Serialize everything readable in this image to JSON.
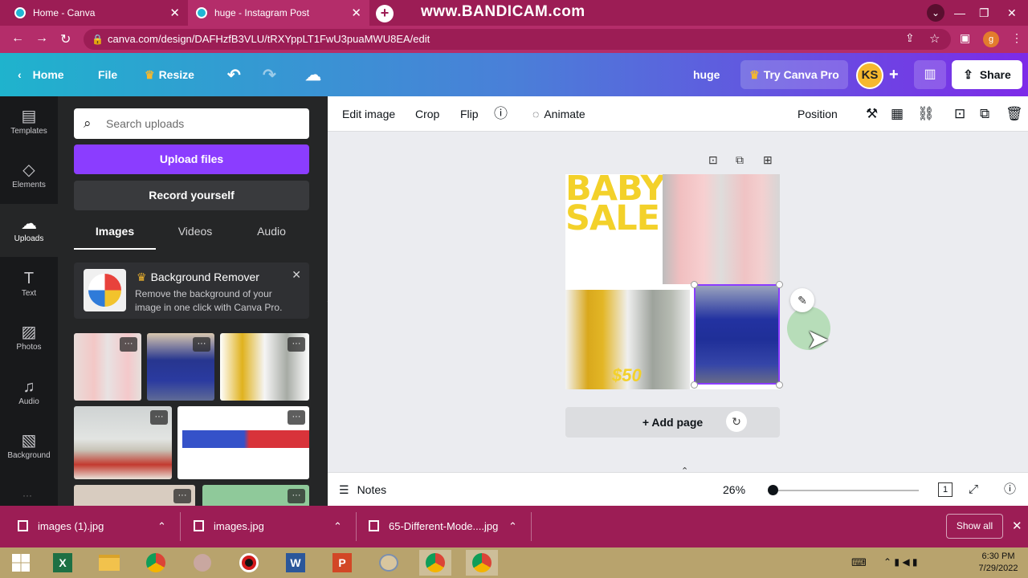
{
  "browser": {
    "tabs": [
      {
        "title": "Home - Canva"
      },
      {
        "title": "huge - Instagram Post"
      }
    ],
    "watermark": "www.BANDICAM.com",
    "url": "canva.com/design/DAFHzfB3VLU/tRXYppLT1FwU3puaMWU8EA/edit",
    "profile_initial": "g"
  },
  "header": {
    "home": "Home",
    "file": "File",
    "resize": "Resize",
    "doc_title": "huge",
    "try_pro": "Try Canva Pro",
    "avatar": "KS",
    "share": "Share",
    "accent": "#7d2ae8"
  },
  "rail": [
    {
      "label": "Templates",
      "icon": "templates-icon"
    },
    {
      "label": "Elements",
      "icon": "elements-icon"
    },
    {
      "label": "Uploads",
      "icon": "uploads-icon"
    },
    {
      "label": "Text",
      "icon": "text-icon"
    },
    {
      "label": "Photos",
      "icon": "photos-icon"
    },
    {
      "label": "Audio",
      "icon": "audio-icon"
    },
    {
      "label": "Background",
      "icon": "background-icon"
    }
  ],
  "panel": {
    "search_placeholder": "Search uploads",
    "upload_files": "Upload files",
    "record_yourself": "Record yourself",
    "tabs": [
      "Images",
      "Videos",
      "Audio"
    ],
    "promo_title": "Background Remover",
    "promo_text": "Remove the background of your image in one click with Canva Pro."
  },
  "toolbar": {
    "edit_image": "Edit image",
    "crop": "Crop",
    "flip": "Flip",
    "animate": "Animate",
    "position": "Position"
  },
  "design": {
    "headline_1": "BABY",
    "headline_2": "SALE",
    "price": "$50",
    "add_page": "+ Add page"
  },
  "footer": {
    "notes": "Notes",
    "zoom": "26%",
    "page_count": "1"
  },
  "downloads": [
    {
      "name": "images (1).jpg"
    },
    {
      "name": "images.jpg"
    },
    {
      "name": "65-Different-Mode....jpg"
    }
  ],
  "show_all": "Show all",
  "clock": {
    "time": "6:30 PM",
    "date": "7/29/2022"
  }
}
